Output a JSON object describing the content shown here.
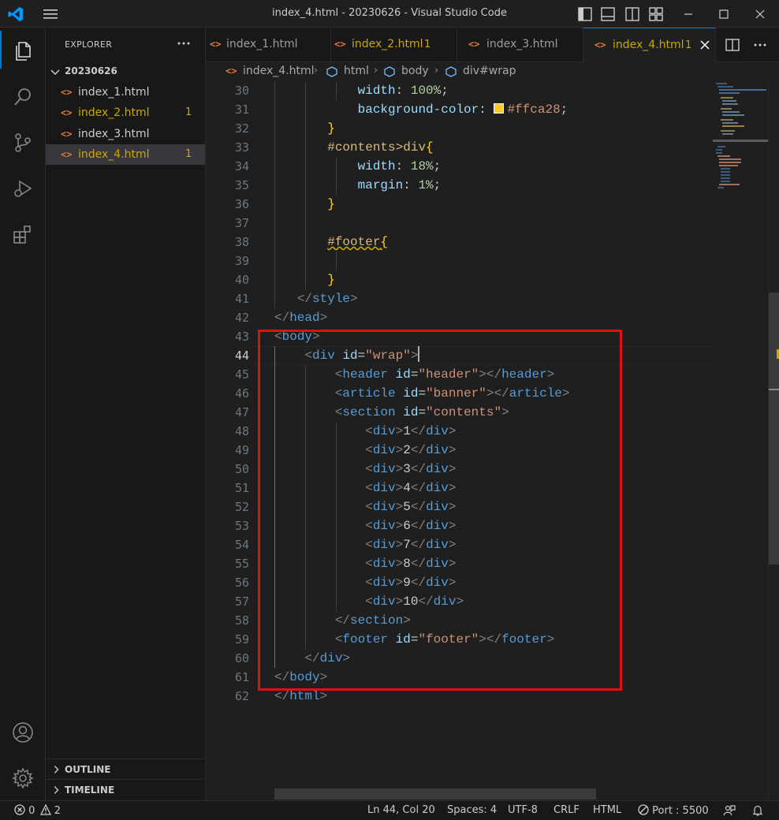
{
  "window": {
    "title": "index_4.html - 20230626 - Visual Studio Code"
  },
  "explorer": {
    "title": "EXPLORER",
    "more": "···",
    "folder": "20230626",
    "files": [
      {
        "name": "index_1.html",
        "badge": ""
      },
      {
        "name": "index_2.html",
        "badge": "1"
      },
      {
        "name": "index_3.html",
        "badge": ""
      },
      {
        "name": "index_4.html",
        "badge": "1"
      }
    ],
    "outline": "OUTLINE",
    "timeline": "TIMELINE"
  },
  "tabs": [
    {
      "label": "index_1.html",
      "badge": ""
    },
    {
      "label": "index_2.html",
      "badge": "1"
    },
    {
      "label": "index_3.html",
      "badge": ""
    },
    {
      "label": "index_4.html",
      "badge": "1"
    }
  ],
  "file_icon": "<>",
  "breadcrumb": {
    "file": "index_4.html",
    "items": [
      "html",
      "body",
      "div#wrap"
    ]
  },
  "editor": {
    "line_numbers": [
      "30",
      "31",
      "32",
      "33",
      "34",
      "35",
      "36",
      "37",
      "38",
      "39",
      "40",
      "41",
      "42",
      "43",
      "44",
      "45",
      "46",
      "47",
      "48",
      "49",
      "50",
      "51",
      "52",
      "53",
      "54",
      "55",
      "56",
      "57",
      "58",
      "59",
      "60",
      "61",
      "62"
    ],
    "current_line": "44",
    "swatch_color": "#ffca28",
    "code": {
      "l30": {
        "prop": "width",
        "colon": ": ",
        "value": "100%",
        "semi": ";"
      },
      "l31": {
        "prop": "background-color",
        "colon": ": ",
        "value": "#ffca28",
        "semi": ";"
      },
      "l32": {
        "brace": "}"
      },
      "l33": {
        "sel": "#contents>div",
        "brace": "{"
      },
      "l34": {
        "prop": "width",
        "colon": ": ",
        "value": "18%",
        "semi": ";"
      },
      "l35": {
        "prop": "margin",
        "colon": ": ",
        "value": "1%",
        "semi": ";"
      },
      "l36": {
        "brace": "}"
      },
      "l38": {
        "sel": "#footer",
        "brace": "{"
      },
      "l40": {
        "brace": "}"
      },
      "l41": {
        "open": "</",
        "name": "style",
        "close": ">"
      },
      "l42": {
        "open": "</",
        "name": "head",
        "close": ">"
      },
      "l43": {
        "open": "<",
        "name": "body",
        "close": ">"
      },
      "l44": {
        "open": "<",
        "name": "div",
        "attr": "id",
        "eq": "=",
        "val": "\"wrap\"",
        "close": ">"
      },
      "l45": {
        "open": "<",
        "name": "header",
        "attr": "id",
        "eq": "=",
        "val": "\"header\"",
        "mid": "></",
        "name2": "header",
        "close": ">"
      },
      "l46": {
        "open": "<",
        "name": "article",
        "attr": "id",
        "eq": "=",
        "val": "\"banner\"",
        "mid": "></",
        "name2": "article",
        "close": ">"
      },
      "l47": {
        "open": "<",
        "name": "section",
        "attr": "id",
        "eq": "=",
        "val": "\"contents\"",
        "close": ">"
      },
      "divs": [
        {
          "open": "<",
          "name": "div",
          "gt": ">",
          "text": "1",
          "lt": "</",
          "name2": "div",
          "close": ">"
        },
        {
          "open": "<",
          "name": "div",
          "gt": ">",
          "text": "2",
          "lt": "</",
          "name2": "div",
          "close": ">"
        },
        {
          "open": "<",
          "name": "div",
          "gt": ">",
          "text": "3",
          "lt": "</",
          "name2": "div",
          "close": ">"
        },
        {
          "open": "<",
          "name": "div",
          "gt": ">",
          "text": "4",
          "lt": "</",
          "name2": "div",
          "close": ">"
        },
        {
          "open": "<",
          "name": "div",
          "gt": ">",
          "text": "5",
          "lt": "</",
          "name2": "div",
          "close": ">"
        },
        {
          "open": "<",
          "name": "div",
          "gt": ">",
          "text": "6",
          "lt": "</",
          "name2": "div",
          "close": ">"
        },
        {
          "open": "<",
          "name": "div",
          "gt": ">",
          "text": "7",
          "lt": "</",
          "name2": "div",
          "close": ">"
        },
        {
          "open": "<",
          "name": "div",
          "gt": ">",
          "text": "8",
          "lt": "</",
          "name2": "div",
          "close": ">"
        },
        {
          "open": "<",
          "name": "div",
          "gt": ">",
          "text": "9",
          "lt": "</",
          "name2": "div",
          "close": ">"
        },
        {
          "open": "<",
          "name": "div",
          "gt": ">",
          "text": "10",
          "lt": "</",
          "name2": "div",
          "close": ">"
        }
      ],
      "l58": {
        "open": "</",
        "name": "section",
        "close": ">"
      },
      "l59": {
        "open": "<",
        "name": "footer",
        "attr": "id",
        "eq": "=",
        "val": "\"footer\"",
        "mid": "></",
        "name2": "footer",
        "close": ">"
      },
      "l60": {
        "open": "</",
        "name": "div",
        "close": ">"
      },
      "l61": {
        "open": "</",
        "name": "body",
        "close": ">"
      },
      "l62": {
        "open": "</",
        "name": "html",
        "close": ">"
      }
    }
  },
  "statusbar": {
    "errors": "0",
    "warnings": "2",
    "position": "Ln 44, Col 20",
    "spaces": "Spaces: 4",
    "encoding": "UTF-8",
    "eol": "CRLF",
    "language": "HTML",
    "port": "Port : 5500"
  },
  "colors": {
    "accent": "#0078d4",
    "warning": "#cca700",
    "highlight_box": "#e01010",
    "html_icon": "#e37933"
  },
  "icons": [
    "vscode-logo-icon",
    "menu-icon",
    "toggle-sidebar-icon",
    "toggle-panel-icon",
    "toggle-secondary-sidebar-icon",
    "customize-layout-icon",
    "minimize-icon",
    "maximize-icon",
    "close-icon",
    "explorer-icon",
    "search-icon",
    "source-control-icon",
    "run-debug-icon",
    "extensions-icon",
    "account-icon",
    "settings-gear-icon",
    "split-editor-icon",
    "more-actions-icon",
    "chevron-down-icon",
    "chevron-right-icon",
    "error-icon",
    "warning-icon",
    "port-icon",
    "feedback-icon",
    "bell-icon",
    "html-file-icon",
    "symbol-icon"
  ]
}
